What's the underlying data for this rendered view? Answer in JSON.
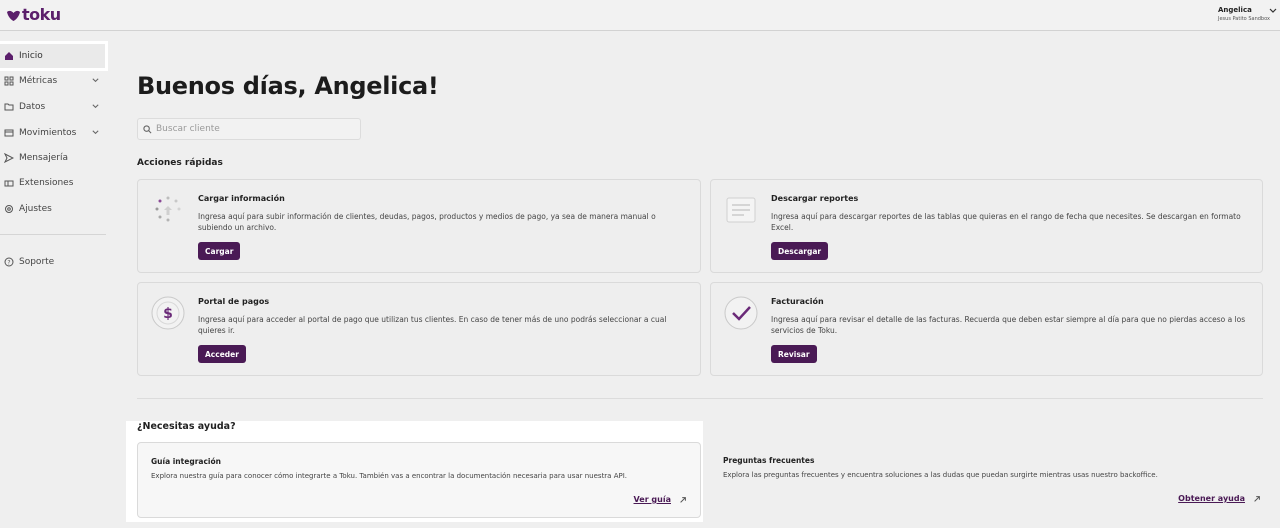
{
  "app": {
    "logo_text": "toku",
    "brand_color": "#5b1f6b",
    "button_color": "#4a1a55"
  },
  "user": {
    "name": "Angelica",
    "org": "Jesus Patito Sandbox"
  },
  "sidebar": {
    "items": [
      {
        "label": "Inicio",
        "icon": "home-icon"
      },
      {
        "label": "Métricas",
        "icon": "grid-icon"
      },
      {
        "label": "Datos",
        "icon": "folder-icon"
      },
      {
        "label": "Movimientos",
        "icon": "card-icon"
      },
      {
        "label": "Mensajería",
        "icon": "send-icon"
      },
      {
        "label": "Extensiones",
        "icon": "extension-icon"
      },
      {
        "label": "Ajustes",
        "icon": "gear-icon"
      },
      {
        "label": "Soporte",
        "icon": "help-icon"
      }
    ]
  },
  "main": {
    "greeting": "Buenos días, Angelica!",
    "search_placeholder": "Buscar cliente",
    "quick_actions_title": "Acciones rápidas",
    "cards": [
      {
        "title": "Cargar información",
        "desc": "Ingresa aquí para subir información de clientes, deudas, pagos, productos y medios de pago, ya sea de manera manual o subiendo un archivo.",
        "button": "Cargar"
      },
      {
        "title": "Descargar reportes",
        "desc": "Ingresa aquí para descargar reportes de las tablas que quieras en el rango de fecha que necesites. Se descargan en formato Excel.",
        "button": "Descargar"
      },
      {
        "title": "Portal de pagos",
        "desc": "Ingresa aquí para acceder al portal de pago que utilizan tus clientes. En caso de tener más de uno podrás seleccionar a cual quieres ir.",
        "button": "Acceder"
      },
      {
        "title": "Facturación",
        "desc": "Ingresa aquí para revisar el detalle de las facturas. Recuerda que deben estar siempre al día para que no pierdas acceso a los servicios de Toku.",
        "button": "Revisar"
      }
    ],
    "help": {
      "title": "¿Necesitas ayuda?",
      "cards": [
        {
          "title": "Guía integración",
          "desc": "Explora nuestra guía para conocer cómo integrarte a Toku. También vas a encontrar la documentación necesaria para usar nuestra API.",
          "link": "Ver guía"
        },
        {
          "title": "Preguntas frecuentes",
          "desc": "Explora las preguntas frecuentes y encuentra soluciones a las dudas que puedan surgirte mientras usas nuestro backoffice.",
          "link": "Obtener ayuda"
        }
      ]
    }
  }
}
